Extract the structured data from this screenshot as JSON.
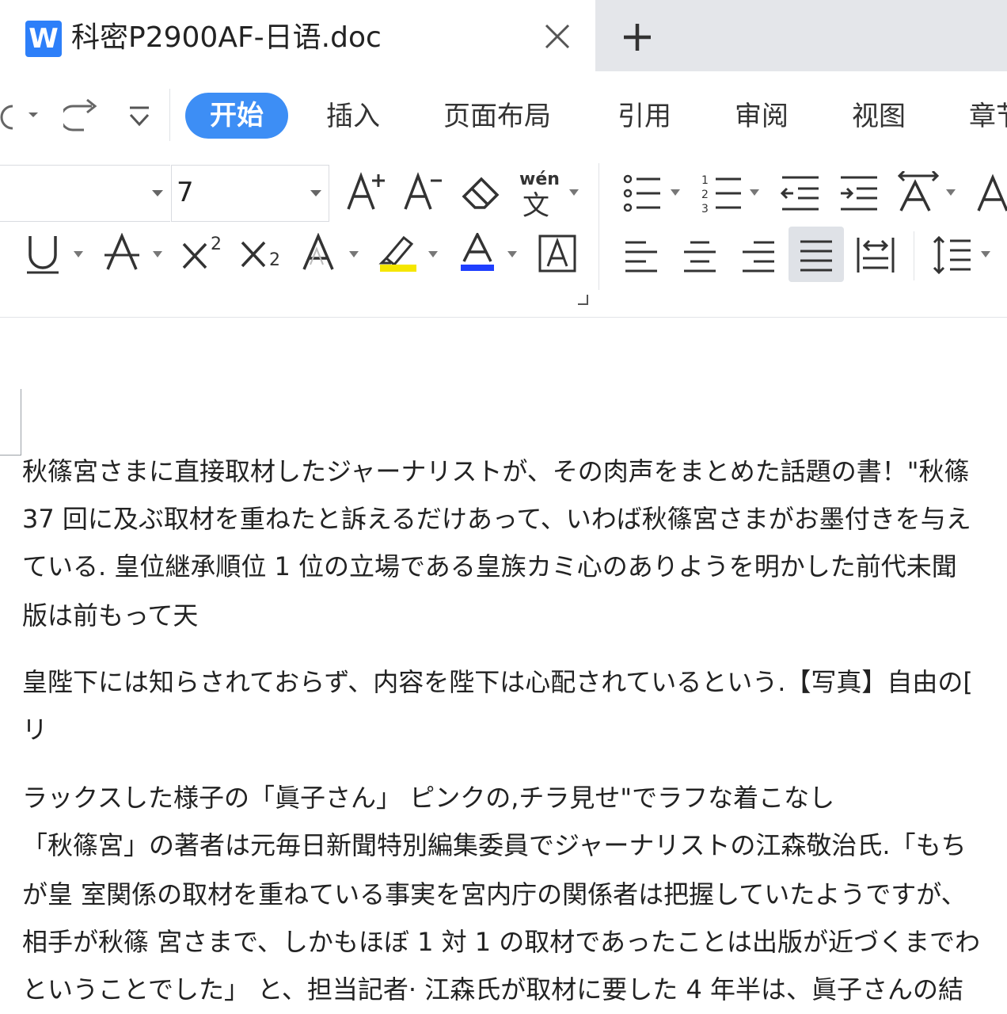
{
  "tab": {
    "app_icon_letter": "W",
    "title": "科密P2900AF-日语.doc",
    "close_icon": "close-icon",
    "add_icon": "plus-icon"
  },
  "menu": {
    "items": [
      "开始",
      "插入",
      "页面布局",
      "引用",
      "审阅",
      "视图",
      "章节"
    ],
    "active_index": 0
  },
  "font": {
    "family_value": "",
    "size_value": "7"
  },
  "colors": {
    "accent": "#3d8ef5",
    "word_icon": "#2d7ff9",
    "highlight_yellow": "#f5e600",
    "font_color_blue": "#1f3fff"
  },
  "tools": {
    "pinyin_label": "wén",
    "pinyin_char": "文",
    "superscript_digit": "2",
    "subscript_digit": "2"
  },
  "document": {
    "lines": [
      "秋篠宮さまに直接取材したジャーナリストが、その肉声をまとめた話題の書！\"秋篠",
      "37 回に及ぶ取材を重ねたと訴えるだけあって、いわば秋篠宮さまがお墨付きを与え",
      "ている. 皇位継承順位 1 位の立場である皇族カミ心のありようを明かした前代未聞",
      "版は前もって天",
      "皇陛下には知らされておらず、内容を陛下は心配されているという.【写真】自由の[",
      "リ",
      "ラックスした様子の「眞子さん」 ピンクの,チラ見せ\"でラフな着こなし",
      "「秋篠宮」の著者は元毎日新聞特別編集委員でジャーナリストの江森敬治氏.「もち",
      "が皇 室関係の取材を重ねている事実を宮内庁の関係者は把握していたようですが、",
      "相手が秋篠 宮さまで、しかもほぼ 1 対 1 の取材であったことは出版が近づくまでわ",
      "ということでした」 と、担当記者· 江森氏が取材に要した 4 年半は、眞子さんの結"
    ]
  }
}
